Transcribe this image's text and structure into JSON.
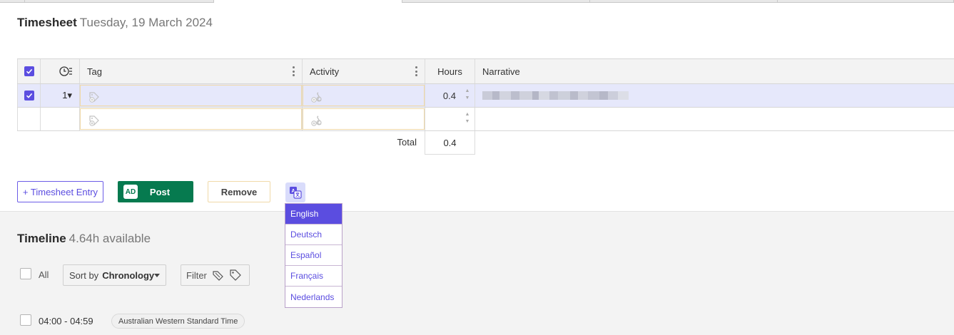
{
  "header": {
    "title": "Timesheet",
    "date": "Tuesday, 19 March 2024"
  },
  "table": {
    "columns": {
      "tag": "Tag",
      "activity": "Activity",
      "hours": "Hours",
      "narrative": "Narrative"
    },
    "rows": [
      {
        "selected": true,
        "index": "1▾",
        "hours": "0.4",
        "narrative_redacted": true
      }
    ],
    "total_label": "Total",
    "total_value": "0.4"
  },
  "actions": {
    "add_entry": "+ Timesheet Entry",
    "post_badge": "AD",
    "post": "Post",
    "remove": "Remove"
  },
  "language_menu": {
    "selected": "English",
    "options": [
      "English",
      "Deutsch",
      "Español",
      "Français",
      "Nederlands"
    ]
  },
  "timeline": {
    "title": "Timeline",
    "available": "4.64h available",
    "all_label": "All",
    "sort_prefix": "Sort by",
    "sort_value": "Chronology",
    "filter_label": "Filter",
    "entries": [
      {
        "time": "04:00 - 04:59",
        "timezone": "Australian Western Standard Time"
      }
    ]
  },
  "colors": {
    "accent": "#5b4de0",
    "post": "#067a4f",
    "row_selected": "#e6e8fb"
  }
}
